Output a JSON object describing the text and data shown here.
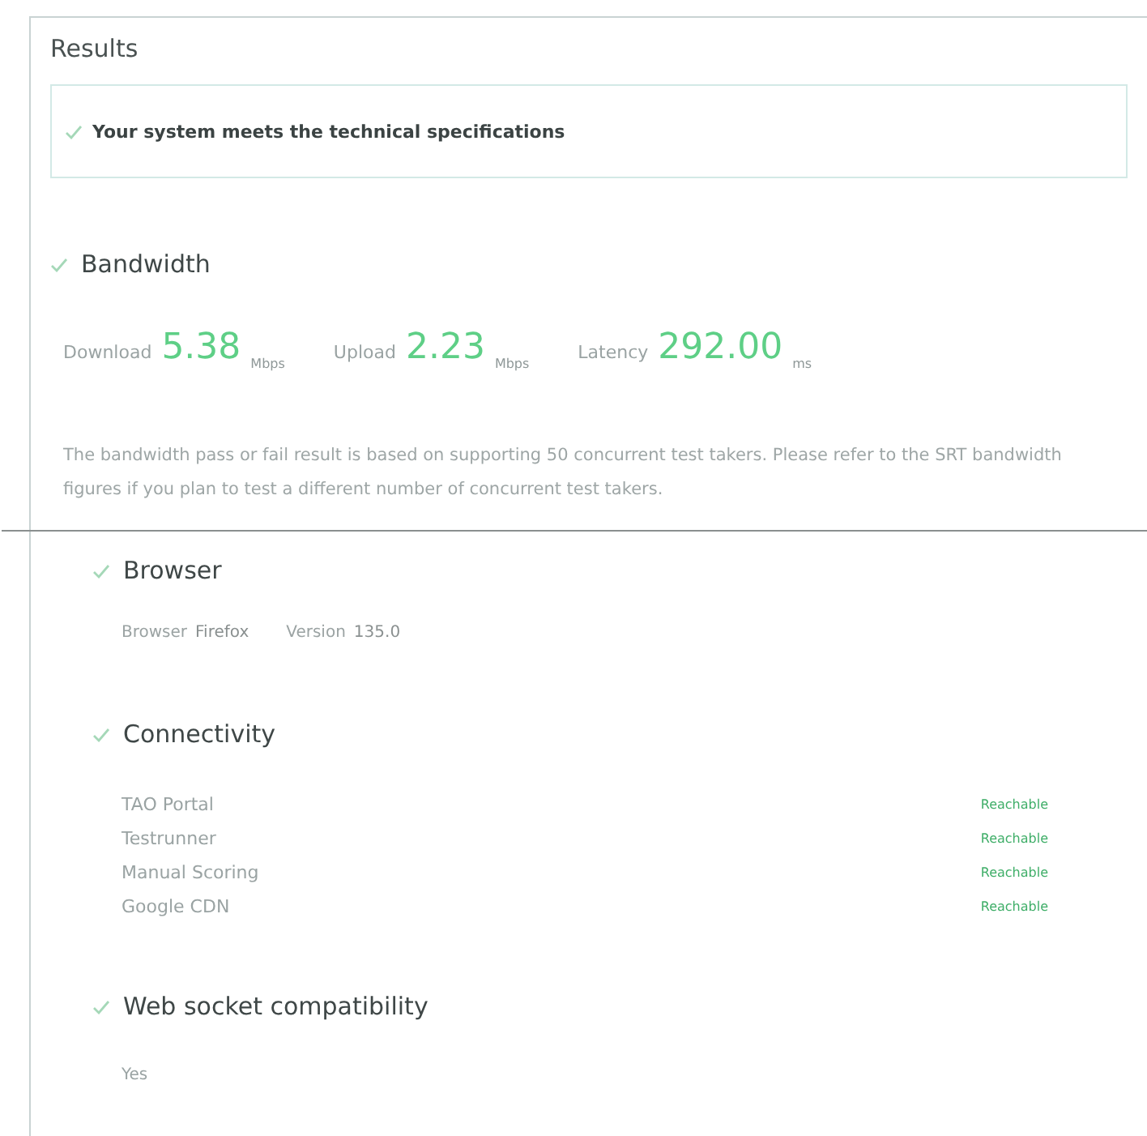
{
  "title": "Results",
  "banner": {
    "passed": true,
    "text": "Your system meets the technical specifications"
  },
  "bandwidth": {
    "title": "Bandwidth",
    "passed": true,
    "metrics": [
      {
        "label": "Download",
        "value": "5.38",
        "unit": "Mbps"
      },
      {
        "label": "Upload",
        "value": "2.23",
        "unit": "Mbps"
      },
      {
        "label": "Latency",
        "value": "292.00",
        "unit": "ms"
      }
    ],
    "note": "The bandwidth pass or fail result is based on supporting 50 concurrent test takers. Please refer to the SRT bandwidth figures if you plan to test a different number of concurrent test takers."
  },
  "browser": {
    "title": "Browser",
    "passed": true,
    "fields": [
      {
        "label": "Browser",
        "value": "Firefox"
      },
      {
        "label": "Version",
        "value": "135.0"
      }
    ]
  },
  "connectivity": {
    "title": "Connectivity",
    "passed": true,
    "rows": [
      {
        "name": "TAO Portal",
        "status": "Reachable"
      },
      {
        "name": "Testrunner",
        "status": "Reachable"
      },
      {
        "name": "Manual Scoring",
        "status": "Reachable"
      },
      {
        "name": "Google CDN",
        "status": "Reachable"
      }
    ]
  },
  "websocket": {
    "title": "Web socket compatibility",
    "passed": true,
    "value": "Yes"
  }
}
